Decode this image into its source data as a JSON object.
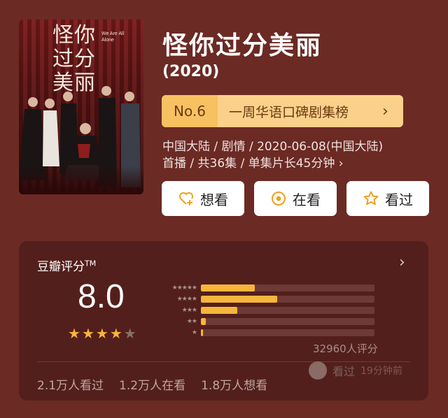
{
  "poster": {
    "title": "怪你过分美丽",
    "subtitle_en": "We Are All Alone"
  },
  "show": {
    "title": "怪你过分美丽",
    "year": "(2020)"
  },
  "ranking": {
    "no": "No.6",
    "list_name": "一周华语口碑剧集榜",
    "chevron": "›"
  },
  "meta": {
    "line1": "中国大陆 / 剧情 / 2020-06-08(中国大陆)",
    "line2": "首播 / 共36集 / 单集片长45分钟 ›"
  },
  "actions": {
    "want": "想看",
    "watching": "在看",
    "watched": "看过"
  },
  "rating": {
    "label": "豆瓣评分",
    "tm": "TM",
    "more": "›",
    "score": "8.0",
    "stars_filled": 4,
    "stars_total": 5,
    "distribution": [
      {
        "stars": "★★★★★",
        "fraction": 0.31
      },
      {
        "stars": "★★★★",
        "fraction": 0.44
      },
      {
        "stars": "★★★",
        "fraction": 0.21
      },
      {
        "stars": "★★",
        "fraction": 0.03
      },
      {
        "stars": "★",
        "fraction": 0.01
      }
    ],
    "votes": "32960人评分",
    "watched": "2.1万人看过",
    "watching": "1.2万人在看",
    "want": "1.8万人想看",
    "recent_action": "看过",
    "recent_time": "19分钟前"
  },
  "colors": {
    "background": "#6b2a24",
    "card": "#531f1c",
    "accent": "#f7b53c",
    "rank_bg": "#fbd08a"
  }
}
